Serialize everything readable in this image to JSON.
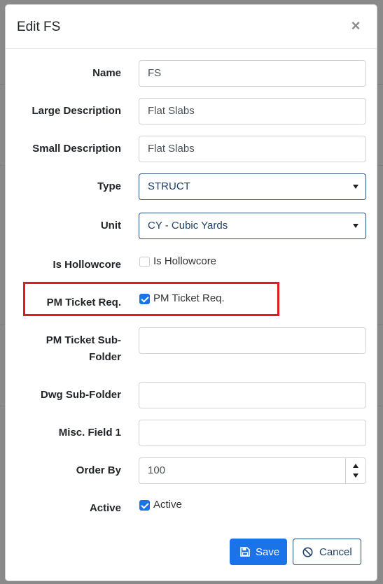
{
  "modal": {
    "title": "Edit FS",
    "close_glyph": "×"
  },
  "fields": {
    "name": {
      "label": "Name",
      "value": "FS"
    },
    "large_description": {
      "label": "Large Description",
      "value": "Flat Slabs"
    },
    "small_description": {
      "label": "Small Description",
      "value": "Flat Slabs"
    },
    "type": {
      "label": "Type",
      "value": "STRUCT"
    },
    "unit": {
      "label": "Unit",
      "value": "CY - Cubic Yards"
    },
    "is_hollowcore": {
      "label": "Is Hollowcore",
      "check_label": "Is Hollowcore",
      "checked": false
    },
    "pm_ticket_req": {
      "label": "PM Ticket Req.",
      "check_label": "PM Ticket Req.",
      "checked": true
    },
    "pm_ticket_sub_folder": {
      "label_line1": "PM Ticket Sub-",
      "label_line2": "Folder",
      "value": ""
    },
    "dwg_sub_folder": {
      "label": "Dwg Sub-Folder",
      "value": ""
    },
    "misc_field_1": {
      "label": "Misc. Field 1",
      "value": ""
    },
    "order_by": {
      "label": "Order By",
      "value": "100"
    },
    "active": {
      "label": "Active",
      "check_label": "Active",
      "checked": true
    }
  },
  "buttons": {
    "save": "Save",
    "cancel": "Cancel"
  },
  "colors": {
    "primary": "#1a73e8",
    "highlight": "#e01b1b",
    "select_border": "#234d7a"
  },
  "icons": {
    "close": "close-icon",
    "select_arrow": "chevron-down-icon",
    "save": "save-icon",
    "cancel": "cancel-icon"
  }
}
